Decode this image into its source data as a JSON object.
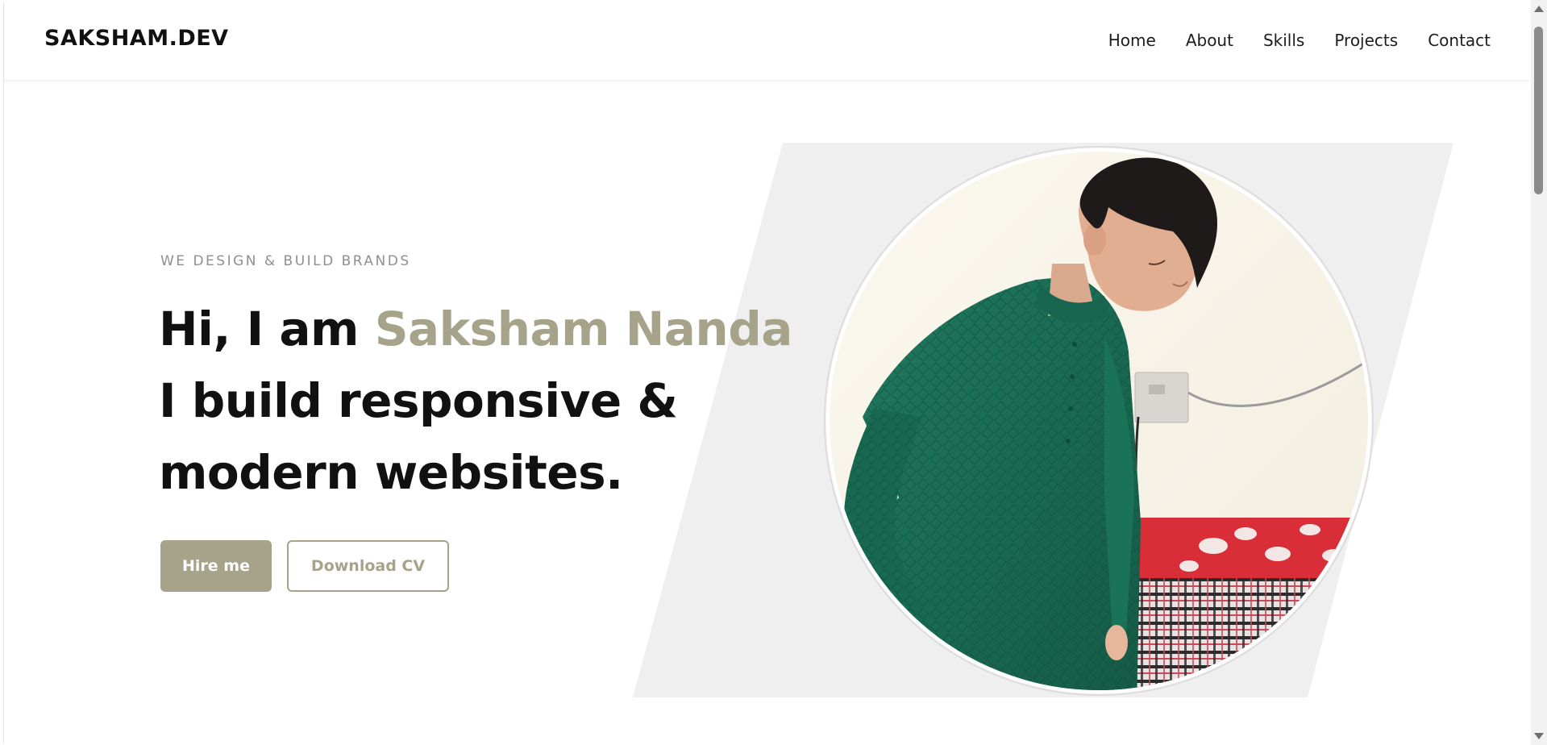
{
  "header": {
    "logo": "SAKSHAM.DEV",
    "nav": [
      {
        "label": "Home"
      },
      {
        "label": "About"
      },
      {
        "label": "Skills"
      },
      {
        "label": "Projects"
      },
      {
        "label": "Contact"
      }
    ]
  },
  "hero": {
    "eyebrow": "WE DESIGN & BUILD BRANDS",
    "greeting": "Hi, I am ",
    "name": "Saksham Nanda",
    "line2": "I build responsive &",
    "line3": "modern websites.",
    "hire_label": "Hire me",
    "cv_label": "Download CV"
  },
  "colors": {
    "accent": "#a6a38a",
    "text": "#111111",
    "panel": "#efefef",
    "kurta_green": "#1b6b55"
  },
  "icons": [
    "scroll-up-arrow-icon",
    "scroll-down-arrow-icon"
  ]
}
